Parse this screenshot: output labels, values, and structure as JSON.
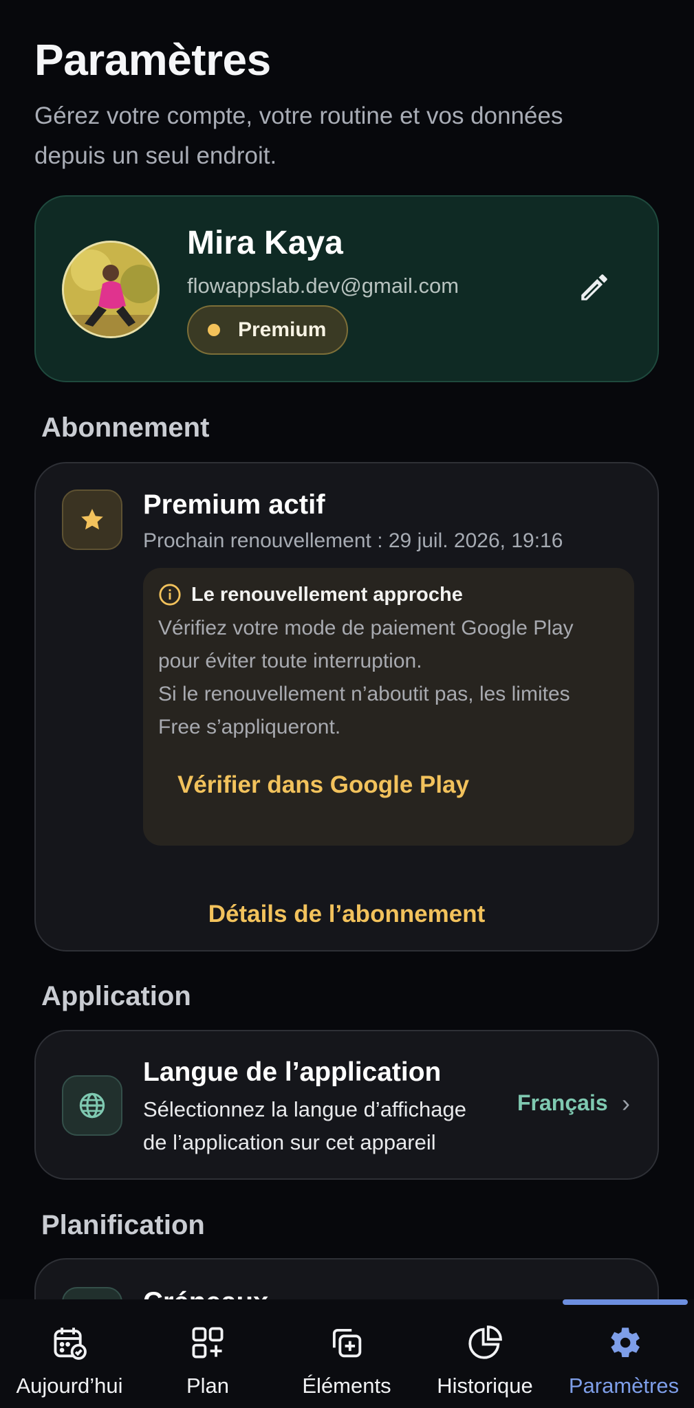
{
  "header": {
    "title": "Paramètres",
    "subtitle": "Gérez votre compte, votre routine et vos données depuis un seul endroit."
  },
  "profile": {
    "name": "Mira Kaya",
    "email": "flowappslab.dev@gmail.com",
    "badge": "Premium"
  },
  "sections": {
    "subscription": "Abonnement",
    "application": "Application",
    "planning": "Planification"
  },
  "subscription": {
    "title": "Premium actif",
    "renewal": "Prochain renouvellement : 29 juil. 2026, 19:16",
    "warning_title": "Le renouvellement approche",
    "warning_line1": "Vérifiez votre mode de paiement Google Play",
    "warning_line2": "pour éviter toute interruption.",
    "warning_line3": "Si le renouvellement n’aboutit pas, les limites",
    "warning_line4": "Free s’appliqueront.",
    "verify_link": "Vérifier dans Google Play",
    "details_link": "Détails de l’abonnement"
  },
  "language": {
    "title": "Langue de l’application",
    "desc_line1": "Sélectionnez la langue d’affichage",
    "desc_line2": "de l’application sur cet appareil",
    "value": "Français"
  },
  "planning_peek": {
    "title": "Créneaux"
  },
  "nav": {
    "items": [
      {
        "label": "Aujourd’hui",
        "icon": "calendar-check-icon"
      },
      {
        "label": "Plan",
        "icon": "grid-plus-icon"
      },
      {
        "label": "Éléments",
        "icon": "add-copy-icon"
      },
      {
        "label": "Historique",
        "icon": "pie-chart-icon"
      },
      {
        "label": "Paramètres",
        "icon": "gear-icon"
      }
    ],
    "active_index": 4
  },
  "colors": {
    "accent_gold": "#f2c25c",
    "accent_teal": "#7fc9b1",
    "active_nav": "#7e9ee8",
    "profile_card": "#0f2a24"
  }
}
